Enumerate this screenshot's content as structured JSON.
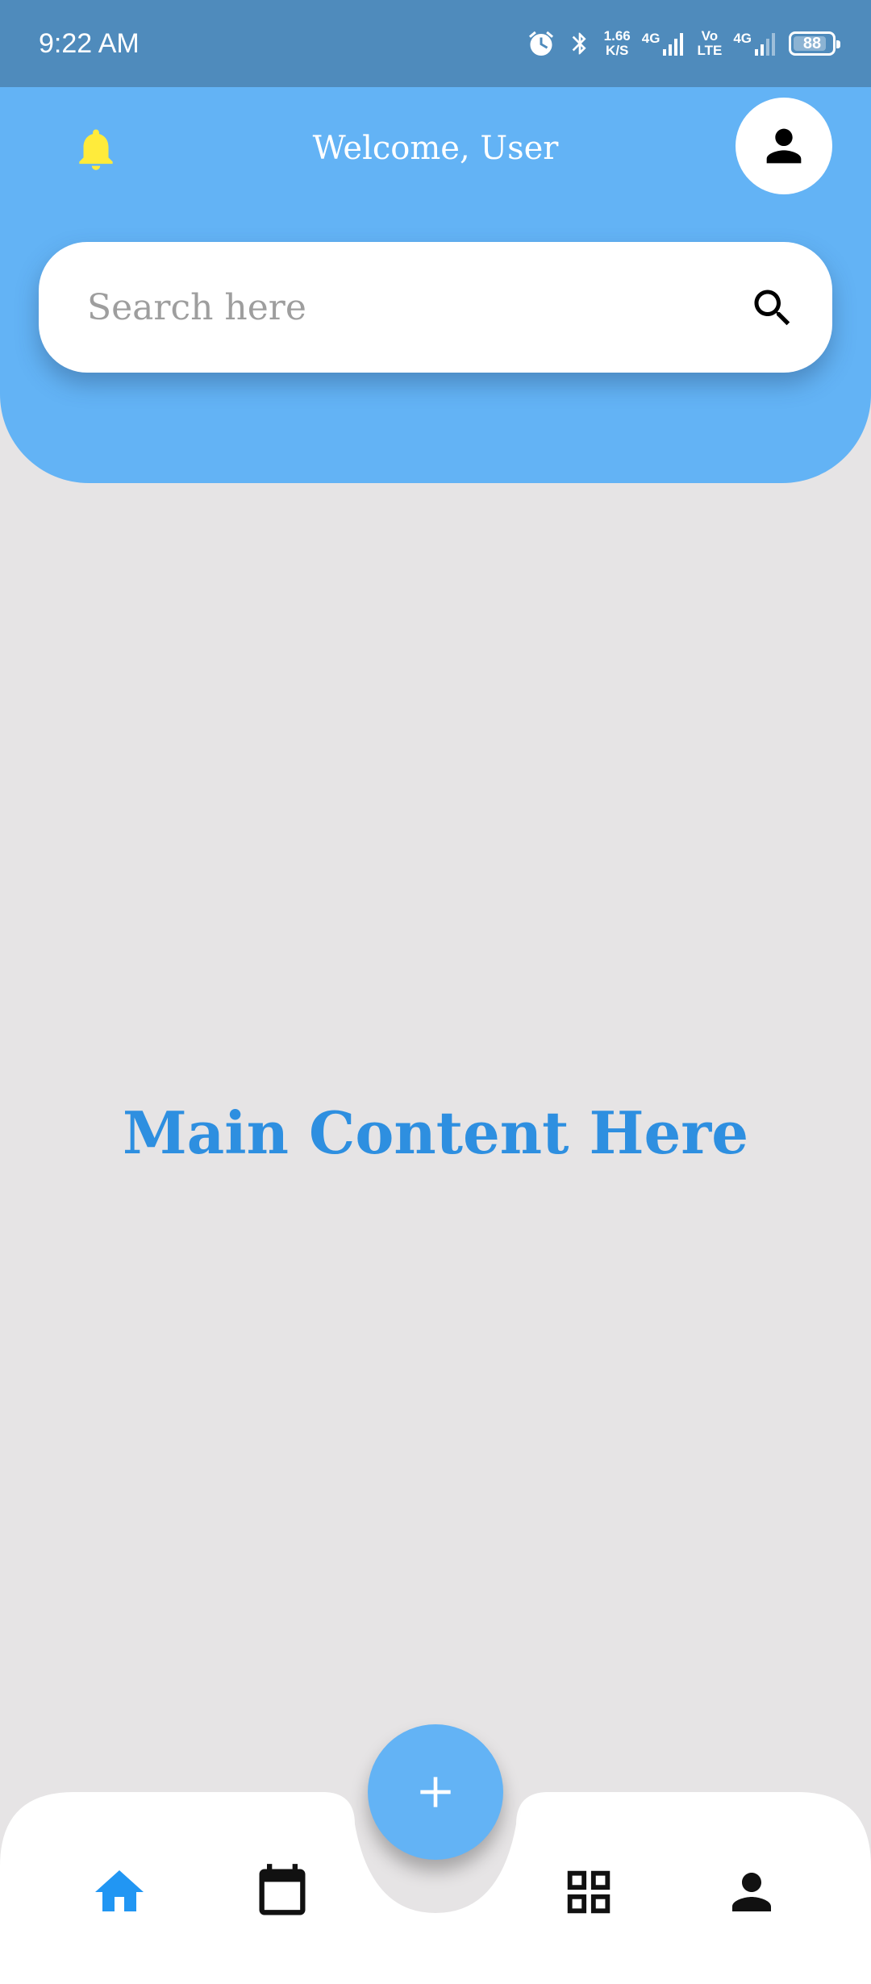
{
  "status_bar": {
    "time": "9:22 AM",
    "net_speed_value": "1.66",
    "net_speed_unit": "K/S",
    "signal_1_label": "4G",
    "volte_top": "Vo",
    "volte_bottom": "LTE",
    "signal_2_label": "4G",
    "battery_level": "88",
    "icons": [
      "alarm-icon",
      "bluetooth-icon",
      "signal-icon",
      "battery-icon"
    ]
  },
  "header": {
    "welcome_text": "Welcome, User",
    "bell_icon": "bell-icon",
    "profile_icon": "person-icon"
  },
  "search": {
    "placeholder": "Search here",
    "value": "",
    "icon": "search-icon"
  },
  "main": {
    "content_text": "Main Content Here"
  },
  "bottom_nav": {
    "items": [
      {
        "icon": "home-icon",
        "active": true
      },
      {
        "icon": "calendar-icon",
        "active": false
      },
      {
        "icon": "grid-icon",
        "active": false
      },
      {
        "icon": "person-icon",
        "active": false
      }
    ],
    "fab_icon": "plus-icon"
  },
  "colors": {
    "status_bar": "#4f8bbc",
    "header": "#63b3f5",
    "background": "#e6e4e5",
    "accent": "#2e8fe0",
    "bell": "#ffeb3b",
    "active_nav": "#2196f3",
    "inactive_nav": "#111111"
  }
}
